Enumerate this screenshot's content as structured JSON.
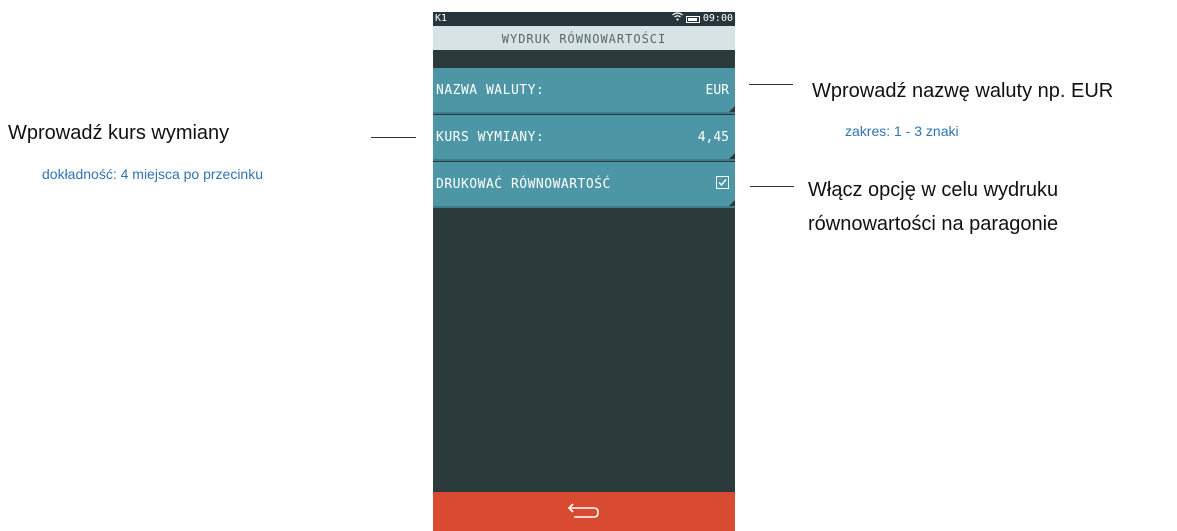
{
  "device": {
    "status": {
      "left": "K1",
      "time": "09:00"
    },
    "title": "WYDRUK RÓWNOWARTOŚCI",
    "rows": [
      {
        "label": "NAZWA WALUTY:",
        "value": "EUR"
      },
      {
        "label": "KURS WYMIANY:",
        "value": "4,45"
      },
      {
        "label": "DRUKOWAĆ RÓWNOWARTOŚĆ",
        "checked": true
      }
    ],
    "footer": {
      "icon": "back-arrow-icon"
    },
    "colors": {
      "screen_bg": "#2b3a3a",
      "row_bg": "#4d96a6",
      "title_bg": "#d7e3e4",
      "footer_bg": "#d94a33"
    }
  },
  "annotations": {
    "left": {
      "main": "Wprowadź kurs wymiany",
      "sub": "dokładność: 4 miejsca po przecinku"
    },
    "right_top": {
      "main": "Wprowadź nazwę waluty np. EUR",
      "sub": "zakres: 1 - 3 znaki"
    },
    "right_bottom": {
      "line1": "Włącz opcję  w celu wydruku",
      "line2": "równowartości na paragonie"
    }
  }
}
